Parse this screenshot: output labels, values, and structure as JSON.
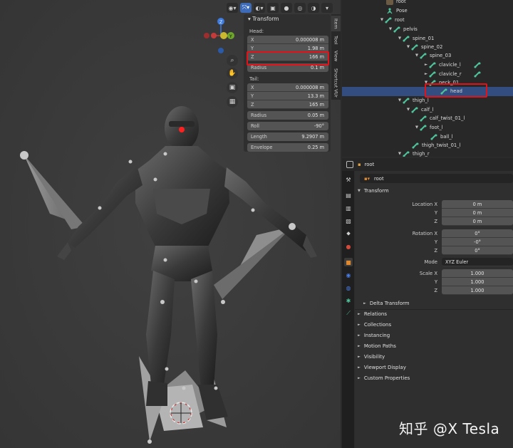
{
  "viewport": {
    "header_icons": [
      "view-icon",
      "select-tool-icon",
      "overlay-icon",
      "xray-icon",
      "shading-solid-icon",
      "shading-material-icon",
      "shading-rendered-icon",
      "chevron-down-icon"
    ],
    "gizmo": {
      "z": "Z",
      "y": "Y"
    },
    "nav_tools": [
      "zoom-icon",
      "hand-icon",
      "camera-icon",
      "grid-icon"
    ]
  },
  "npanel": {
    "title": "Transform",
    "head_label": "Head:",
    "head": [
      {
        "label": "X",
        "value": "0.000008 m"
      },
      {
        "label": "Y",
        "value": "1.98 m"
      },
      {
        "label": "Z",
        "value": "166 m"
      }
    ],
    "head_radius": {
      "label": "Radius",
      "value": "0.1 m"
    },
    "tail_label": "Tail:",
    "tail": [
      {
        "label": "X",
        "value": "0.000008 m"
      },
      {
        "label": "Y",
        "value": "13.3 m"
      },
      {
        "label": "Z",
        "value": "165 m"
      }
    ],
    "tail_radius": {
      "label": "Radius",
      "value": "0.05 m"
    },
    "roll": {
      "label": "Roll",
      "value": "-90°"
    },
    "length": {
      "label": "Length",
      "value": "9.2907 m"
    },
    "envelope": {
      "label": "Envelope",
      "value": "0.25 m"
    },
    "tabs": [
      "Item",
      "Tool",
      "View",
      "Shortcut VUr"
    ]
  },
  "outliner": {
    "rows": [
      {
        "label": "root",
        "indent": 60
      },
      {
        "label": "Pose",
        "indent": 60
      },
      {
        "label": "root",
        "indent": 52
      },
      {
        "label": "pelvis",
        "indent": 64
      },
      {
        "label": "spine_01",
        "indent": 78
      },
      {
        "label": "spine_02",
        "indent": 90
      },
      {
        "label": "spine_03",
        "indent": 102
      },
      {
        "label": "clavicle_l",
        "indent": 116
      },
      {
        "label": "clavicle_r",
        "indent": 116
      },
      {
        "label": "neck_01",
        "indent": 116
      },
      {
        "label": "head",
        "indent": 128
      },
      {
        "label": "thigh_l",
        "indent": 78
      },
      {
        "label": "calf_l",
        "indent": 90
      },
      {
        "label": "calf_twist_01_l",
        "indent": 102
      },
      {
        "label": "foot_l",
        "indent": 102
      },
      {
        "label": "ball_l",
        "indent": 114
      },
      {
        "label": "thigh_twist_01_l",
        "indent": 90
      },
      {
        "label": "thigh_r",
        "indent": 78
      }
    ]
  },
  "properties": {
    "breadcrumb": "root",
    "object_name": "root",
    "transform_label": "Transform",
    "location": [
      {
        "label": "Location X",
        "value": "0 m"
      },
      {
        "label": "Y",
        "value": "0 m"
      },
      {
        "label": "Z",
        "value": "0 m"
      }
    ],
    "rotation": [
      {
        "label": "Rotation X",
        "value": "0°"
      },
      {
        "label": "Y",
        "value": "-0°"
      },
      {
        "label": "Z",
        "value": "0°"
      }
    ],
    "mode": {
      "label": "Mode",
      "value": "XYZ Euler"
    },
    "scale": [
      {
        "label": "Scale X",
        "value": "1.000"
      },
      {
        "label": "Y",
        "value": "1.000"
      },
      {
        "label": "Z",
        "value": "1.000"
      }
    ],
    "delta_transform": "Delta Transform",
    "panels": [
      "Relations",
      "Collections",
      "Instancing",
      "Motion Paths",
      "Visibility",
      "Viewport Display",
      "Custom Properties"
    ]
  },
  "watermark": "知乎 @X Tesla",
  "colors": {
    "highlight": "#e0131b",
    "selected_row": "#334d80",
    "bone_icon": "#4fc39b"
  }
}
